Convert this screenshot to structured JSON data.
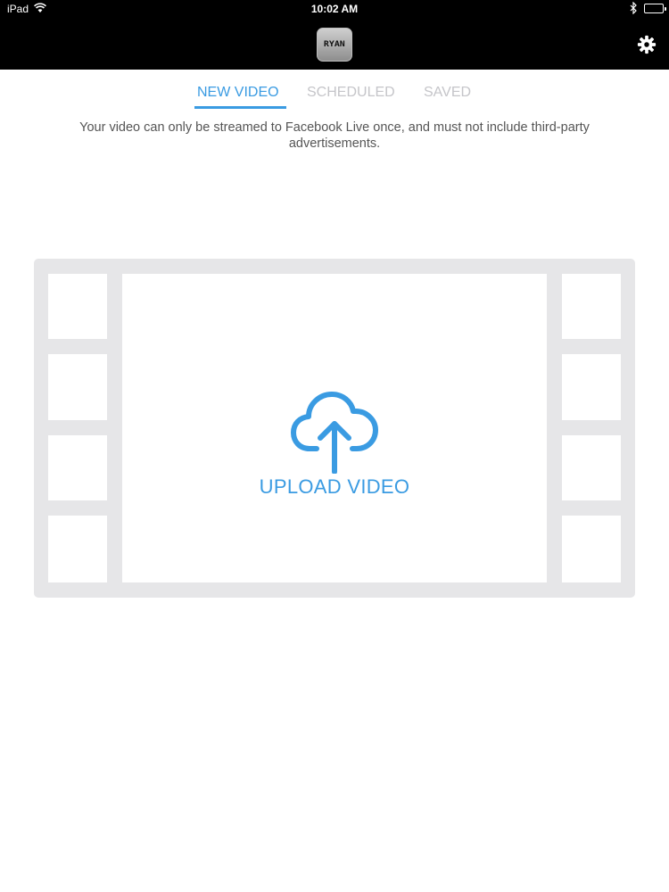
{
  "status_bar": {
    "device": "iPad",
    "time": "10:02 AM",
    "icons": [
      "wifi-icon",
      "bluetooth-icon",
      "battery-icon"
    ]
  },
  "nav": {
    "logo_text": "RYAN",
    "settings_icon": "gear-icon"
  },
  "tabs": [
    {
      "label": "NEW VIDEO",
      "active": true
    },
    {
      "label": "SCHEDULED",
      "active": false
    },
    {
      "label": "SAVED",
      "active": false
    }
  ],
  "notice": "Your video can only be streamed to Facebook Live once, and must not include third-party advertisements.",
  "upload": {
    "label": "UPLOAD VIDEO",
    "icon": "cloud-upload-icon"
  },
  "colors": {
    "accent": "#3a9be2",
    "inactive_tab": "#c5c5c9",
    "filmstrip": "#e6e6e8",
    "bar": "#000000"
  }
}
